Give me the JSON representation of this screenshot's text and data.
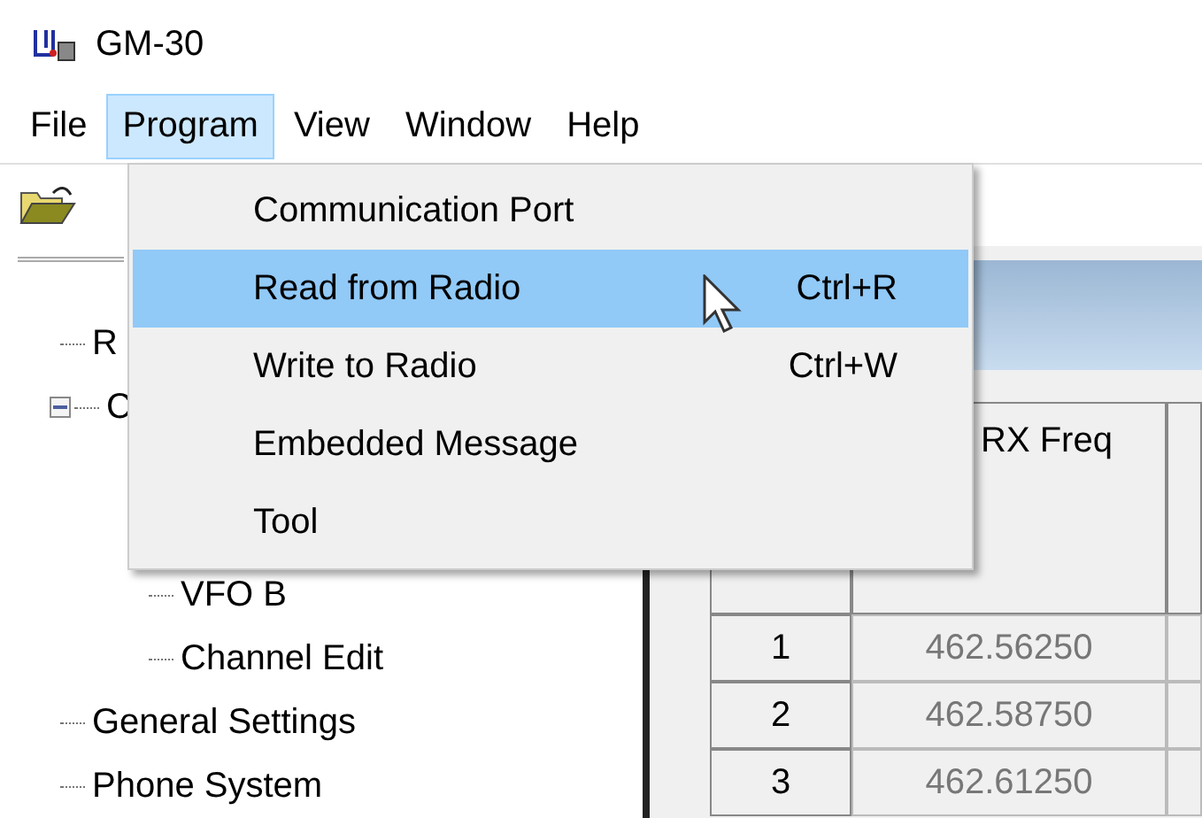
{
  "window": {
    "title": "GM-30"
  },
  "menu_bar": [
    {
      "label": "File",
      "selected": false
    },
    {
      "label": "Program",
      "selected": true
    },
    {
      "label": "View",
      "selected": false
    },
    {
      "label": "Window",
      "selected": false
    },
    {
      "label": "Help",
      "selected": false
    }
  ],
  "program_menu": [
    {
      "label": "Communication Port",
      "selected": false
    },
    {
      "label": "Read from Radio",
      "shortcut": "Ctrl+R",
      "selected": true
    },
    {
      "label": "Write to Radio",
      "shortcut": "Ctrl+W",
      "selected": false
    },
    {
      "label": "Embedded Message",
      "selected": false
    },
    {
      "label": "Tool",
      "selected": false
    }
  ],
  "tree": [
    {
      "label": "R"
    },
    {
      "label": "C",
      "expanded": true,
      "children": [
        {
          "label": "VFO B"
        },
        {
          "label": "Channel Edit"
        }
      ]
    },
    {
      "label": "General Settings"
    },
    {
      "label": "Phone System"
    }
  ],
  "table": {
    "columns": [
      "RX Freq"
    ],
    "rows": [
      {
        "number": "1",
        "rx_freq": "462.56250"
      },
      {
        "number": "2",
        "rx_freq": "462.58750"
      },
      {
        "number": "3",
        "rx_freq": "462.61250"
      }
    ]
  }
}
